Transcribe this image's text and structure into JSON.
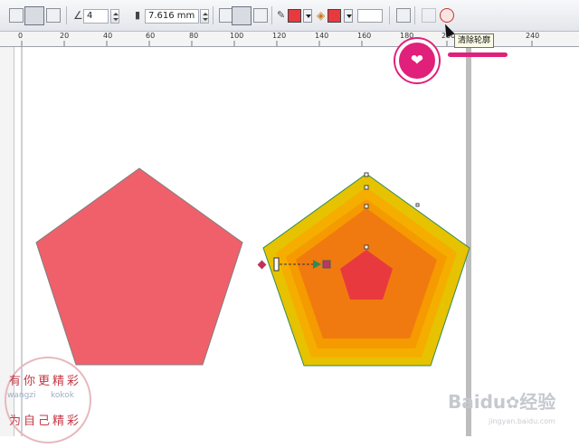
{
  "toolbar": {
    "outline_width_value": "4",
    "size_value": "7.616 mm",
    "fill_color": "#e8393f",
    "outline_color": "#e8393f",
    "second_fill_color": "#ffffff"
  },
  "ruler": {
    "ticks": [
      "0",
      "20",
      "40",
      "60",
      "80",
      "100",
      "120",
      "140",
      "160",
      "180",
      "200",
      "240"
    ]
  },
  "tooltip": {
    "text": "清除轮廓"
  },
  "canvas": {
    "left_pentagon_color": "#f0606a",
    "layers": [
      "#e6c200",
      "#f5ae00",
      "#f59a00",
      "#f07a10",
      "#e8393f"
    ],
    "outline_color": "#2e8b57"
  },
  "watermarks": {
    "left_lines": [
      "有",
      "你",
      "更",
      "精",
      "彩",
      "wangzi",
      "kokok",
      "为",
      "自",
      "己",
      "精",
      "彩"
    ],
    "right_brand": "Baidu",
    "right_suffix": "经验",
    "right_url": "jingyan.baidu.com"
  }
}
